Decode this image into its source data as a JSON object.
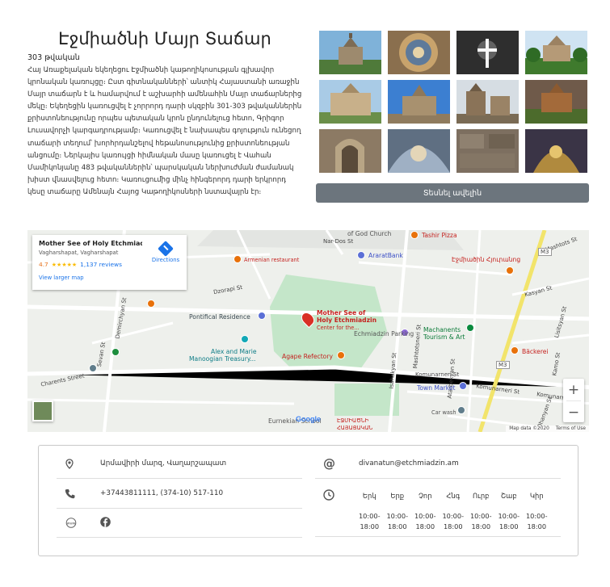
{
  "page": {
    "title": "Էջմիածնի Մայր Տաճար",
    "year": "303 թվական",
    "description": "Հայ Առաքելական եկեղեցու Էջմիածնի կաթողիկոսության գլխավոր կրոնական կառույցը։ Ըստ գիտնականների՝ անտիկ Հայաստանի առաջին Մայր տաճարն է և համարվում է աշխարհի ամենահին Մայր տաճարներից մեկը։ Եկեղեցին կառուցվել է չորրորդ դարի սկզբին 301-303 թվականներին քրիստոնեությունը որպես պետական կրոն ընդունելուց հետո, Գրիգոր Լուսավորչի կարգադրությամբ։ Կառուցվել է նախապես գոյություն ունեցող տաճարի տեղում՝ խորհրդանշելով հեթանոսությունից քրիստոնեության անցումը։ Ներկայիս կառույցի հիմնական մասը կառուցել է Վահան Մամիկոնյանը 483 թվականներին՝ պարսկական ներխուժման ժամանակ խիստ վնասվելուց հետո։ Կառուցումից մինչ հինգերորդ դարի երկրորդ կեսը տաճարը Ամենայն Հայոց Կաթողիկոսների նստավայրն էր։"
  },
  "gallery": {
    "thumbs": [
      {
        "icon": "church-exterior-photo"
      },
      {
        "icon": "dome-interior-photo"
      },
      {
        "icon": "cross-light-photo"
      },
      {
        "icon": "church-garden-photo"
      },
      {
        "icon": "church-facade-photo"
      },
      {
        "icon": "church-blue-sky-photo"
      },
      {
        "icon": "church-belfry-photo"
      },
      {
        "icon": "church-sunset-photo"
      },
      {
        "icon": "carved-arch-photo"
      },
      {
        "icon": "painted-dome-photo"
      },
      {
        "icon": "stone-wall-photo"
      },
      {
        "icon": "gilded-interior-photo"
      }
    ],
    "more_button": "Տեսնել ավելին"
  },
  "map": {
    "card": {
      "name": "Mother See of Holy Etchmiadz...",
      "address": "Vagharshapat, Vagharshapat",
      "rating": "4.7",
      "stars": "★★★★★",
      "reviews": "1,137 reviews",
      "larger_map": "View larger map",
      "directions": "Directions"
    },
    "labels": {
      "god_church": "of God Church",
      "tashir": "Tashir Pizza",
      "ararat_bank": "AraratBank",
      "armenian_restaurant": "Armenian restaurant",
      "ejmiatsin_hotel": "Էջմիածին Հյուրանոց",
      "pontifical": "Pontifical Residence",
      "mother_see_1": "Mother See of",
      "mother_see_2": "Holy Etchmiadzin",
      "mother_see_3": "Center for the...",
      "alex_marie_1": "Alex and Marie",
      "alex_marie_2": "Manoogian Treasury...",
      "parking": "Echmiadzin Parking",
      "machanents_1": "Machanents",
      "machanents_2": "Tourism & Art",
      "agape": "Agape Refectory",
      "backerei": "Bäckerei",
      "town_market": "Town Market",
      "car_wash": "Car wash",
      "eurnekian": "Eurnekian School",
      "ejm_school_1": "ԷՋՄԻԱԾՆԻ",
      "ejm_school_2": "ՀԱՅԱՑԱԿԱՆ",
      "charents": "Charents Street",
      "komunarneri_1": "Komunarneri St",
      "komunarneri_2": "Komunarneri St",
      "komunarneri_3": "Komunarneri St",
      "m3a": "M3",
      "m3b": "M3",
      "nar_dos": "Nar-Dos St",
      "mashtoc": "Mashtots St",
      "kasyan": "Kasyan St",
      "lisitsyan": "Lisitsyan St",
      "demirchyan": "Demirchyan St",
      "sevan": "Sevan St",
      "kamo": "Kamo St",
      "isahakyan": "Isahakyan St",
      "atarbekyan": "Atarbekyan St",
      "mashtocner": "Mashtotsneri St",
      "dzorapi": "Dzorapi St",
      "ohanyan": "Ohanyan St"
    },
    "zoom_in": "+",
    "zoom_out": "−",
    "google": "Google",
    "attribution": "Map data ©2020",
    "terms": "Terms of Use"
  },
  "contacts": {
    "address": "Արմավիրի մարզ, Վաղարշապատ",
    "phone": "+37443811111, (374-10) 517-110",
    "email": "divanatun@etchmiadzin.am",
    "www_icon": "www",
    "address_icon": "map-pin-icon",
    "phone_icon": "phone-icon",
    "facebook_icon": "facebook-icon",
    "email_icon": "at-sign-icon",
    "clock_icon": "clock-icon"
  },
  "hours": {
    "days": [
      "Երկ",
      "Երք",
      "Չոր",
      "Հնգ",
      "Ուրբ",
      "Շաբ",
      "Կիր"
    ],
    "times": [
      "10:00-18:00",
      "10:00-18:00",
      "10:00-18:00",
      "10:00-18:00",
      "10:00-18:00",
      "10:00-18:00",
      "10:00-18:00"
    ]
  },
  "colors": {
    "button": "#6c757d",
    "link": "#1a73e8",
    "poi_red": "#d93025",
    "map_green": "#a8dab5"
  }
}
